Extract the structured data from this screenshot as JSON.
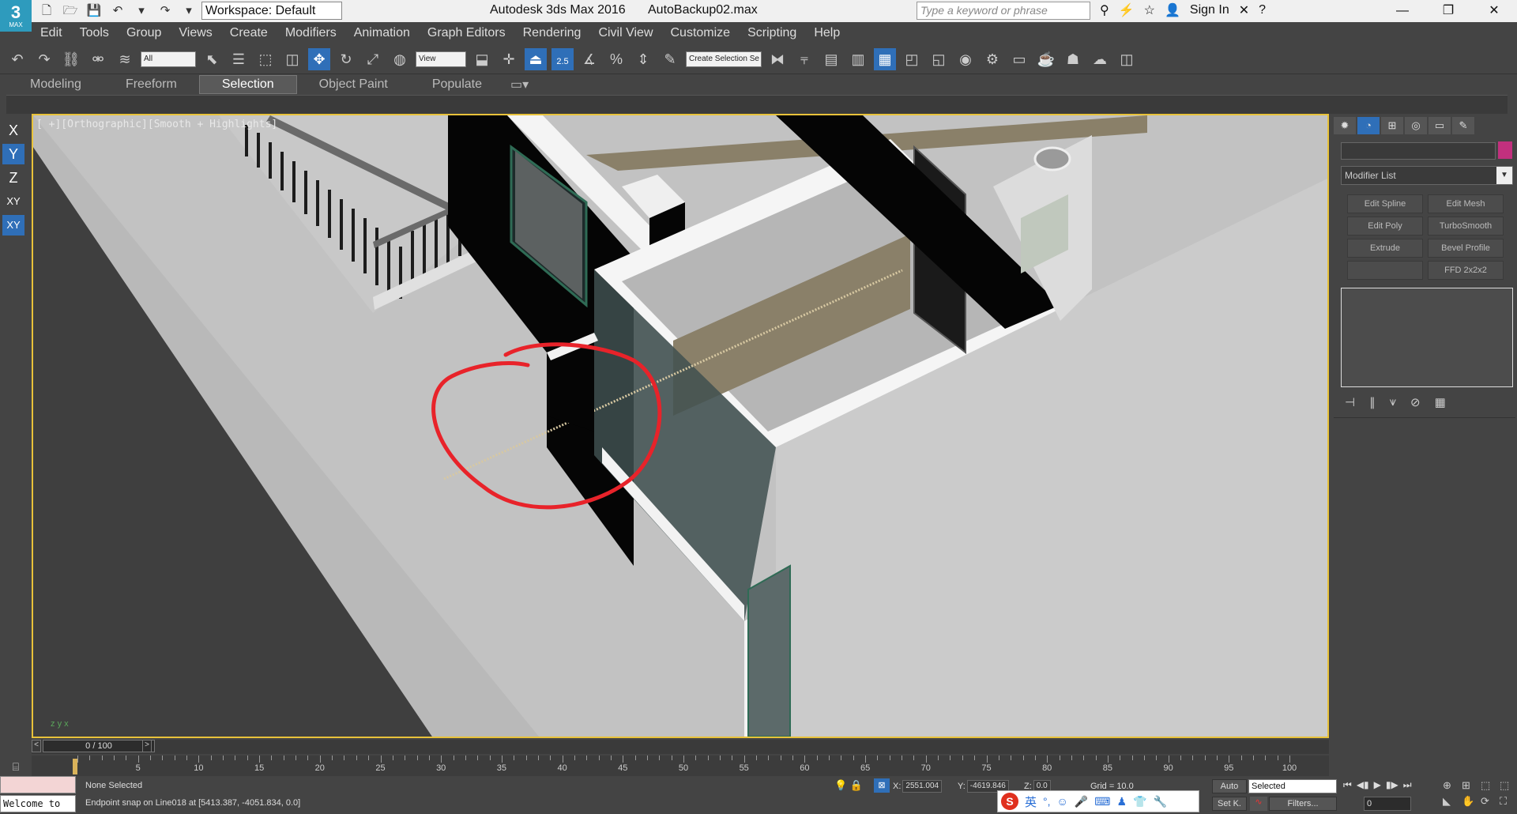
{
  "app": {
    "logo_big": "3",
    "logo_small": "MAX",
    "title": "Autodesk 3ds Max 2016",
    "file": "AutoBackup02.max",
    "workspace": "Workspace: Default",
    "search_placeholder": "Type a keyword or phrase",
    "sign_in": "Sign In"
  },
  "menu": [
    "Edit",
    "Tools",
    "Group",
    "Views",
    "Create",
    "Modifiers",
    "Animation",
    "Graph Editors",
    "Rendering",
    "Civil View",
    "Customize",
    "Scripting",
    "Help"
  ],
  "toolbar": {
    "filter": "All",
    "ref_coord": "View",
    "snap_label": "2.5",
    "selection_set": "Create Selection Se"
  },
  "ribbon": {
    "tabs": [
      "Modeling",
      "Freeform",
      "Selection",
      "Object Paint",
      "Populate"
    ],
    "active": "Selection"
  },
  "axes": [
    "X",
    "Y",
    "Z",
    "XY",
    "XY"
  ],
  "viewport": {
    "label": "[ +][Orthographic][Smooth + Highlights]",
    "axis_y": "y",
    "axis_z": "z",
    "axis_x": "x"
  },
  "command_panel": {
    "modifier_list": "Modifier List",
    "buttons": [
      "Edit Spline",
      "Edit Mesh",
      "Edit Poly",
      "TurboSmooth",
      "Extrude",
      "Bevel Profile",
      "",
      "FFD 2x2x2"
    ]
  },
  "time": {
    "thumb": "0 / 100",
    "ticks": [
      "5",
      "10",
      "15",
      "20",
      "25",
      "30",
      "35",
      "40",
      "45",
      "50",
      "55",
      "60",
      "65",
      "70",
      "75",
      "80",
      "85",
      "90",
      "95",
      "100"
    ]
  },
  "status": {
    "maxscript": "Welcome to",
    "selection": "None Selected",
    "prompt": "Endpoint snap on Line018 at [5413.387, -4051.834, 0.0]",
    "x_label": "X:",
    "x": "2551.004",
    "y_label": "Y:",
    "y": "-4619.846",
    "z_label": "Z:",
    "z": "0.0",
    "grid": "Grid = 10.0",
    "auto": "Auto",
    "set_key": "Set K.",
    "key_mode": "Selected",
    "filters": "Filters...",
    "frame": "0"
  },
  "ime": {
    "logo": "S",
    "lang": "英"
  },
  "colors": {
    "accent": "#2f6fb8",
    "viewport_border": "#e8c23a",
    "annotation": "#e8232a",
    "object_color": "#c2307e"
  }
}
